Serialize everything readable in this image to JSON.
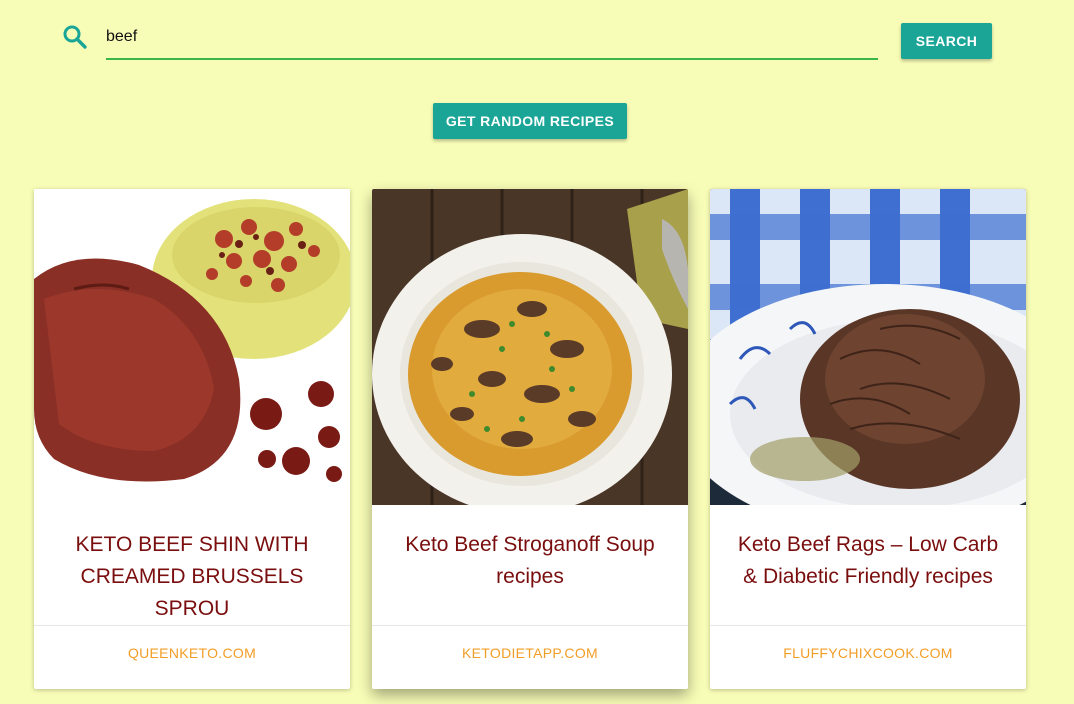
{
  "search": {
    "value": "beef",
    "icon": "search-icon",
    "button_label": "SEARCH"
  },
  "random_button_label": "GET RANDOM RECIPES",
  "colors": {
    "background": "#f7fcb6",
    "accent": "#1aa597",
    "underline": "#3bb54a",
    "title": "#7a0e0e",
    "source": "#f29d26"
  },
  "recipes": [
    {
      "title": "KETO BEEF SHIN WITH CREAMED BRUSSELS SPROU",
      "source": "QUEENKETO.COM"
    },
    {
      "title": "Keto Beef Stroganoff Soup recipes",
      "source": "KETODIETAPP.COM"
    },
    {
      "title": "Keto Beef Rags – Low Carb & Diabetic Friendly recipes",
      "source": "FLUFFYCHIXCOOK.COM"
    }
  ]
}
